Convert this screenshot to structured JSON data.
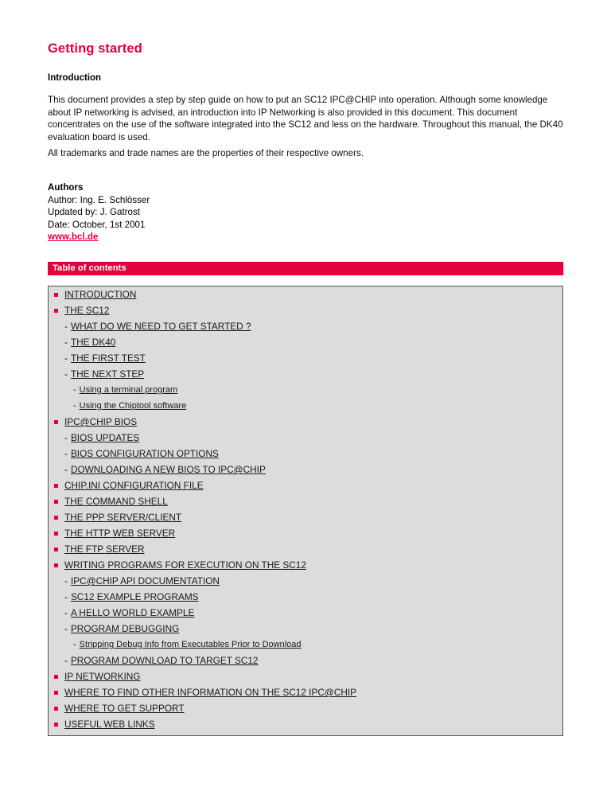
{
  "document": {
    "title": "Getting started",
    "title_color": "#E4003C"
  },
  "introduction": {
    "heading": "Introduction",
    "paragraph_1": "This document provides a step by step guide on how to put an SC12 IPC@CHIP into operation. Although some knowledge about IP networking is advised, an introduction into IP Networking is also provided in this document. This document concentrates on the use of the software integrated into the SC12 and less on the hardware. Throughout this manual, the DK40 evaluation board is used.",
    "paragraph_2": "All trademarks and trade names are the properties of their respective owners."
  },
  "authors": {
    "heading": "Authors",
    "author": "Author: Ing. E. Schlösser",
    "updated_by": "Updated by: J. Gatrost",
    "date": "Date: October, 1st 2001",
    "website": "www.bcl.de"
  },
  "toc": {
    "bar_label": "Table of contents",
    "bar_color": "#E4003C",
    "box_background": "#DCDCDC",
    "bullet_color": "#E4003C",
    "dash": "-",
    "items": [
      {
        "level": 1,
        "label": "INTRODUCTION"
      },
      {
        "level": 1,
        "label": "THE SC12"
      },
      {
        "level": 2,
        "label": "WHAT DO WE NEED TO GET STARTED ?"
      },
      {
        "level": 2,
        "label": "THE DK40"
      },
      {
        "level": 2,
        "label": "THE FIRST TEST"
      },
      {
        "level": 2,
        "label": "THE NEXT STEP"
      },
      {
        "level": 3,
        "label": "Using a terminal program"
      },
      {
        "level": 3,
        "label": "Using the Chiptool software"
      },
      {
        "level": 1,
        "label": "IPC@CHIP BIOS"
      },
      {
        "level": 2,
        "label": "BIOS UPDATES"
      },
      {
        "level": 2,
        "label": "BIOS CONFIGURATION OPTIONS"
      },
      {
        "level": 2,
        "label": "DOWNLOADING A NEW BIOS TO IPC@CHIP"
      },
      {
        "level": 1,
        "label": "CHIP.INI CONFIGURATION FILE"
      },
      {
        "level": 1,
        "label": "THE COMMAND SHELL"
      },
      {
        "level": 1,
        "label": "THE PPP SERVER/CLIENT"
      },
      {
        "level": 1,
        "label": "THE HTTP WEB SERVER"
      },
      {
        "level": 1,
        "label": "THE FTP SERVER"
      },
      {
        "level": 1,
        "label": "WRITING PROGRAMS FOR EXECUTION ON THE SC12"
      },
      {
        "level": 2,
        "label": "IPC@CHIP API DOCUMENTATION"
      },
      {
        "level": 2,
        "label": "SC12 EXAMPLE PROGRAMS"
      },
      {
        "level": 2,
        "label": "A HELLO WORLD EXAMPLE"
      },
      {
        "level": 2,
        "label": "PROGRAM DEBUGGING"
      },
      {
        "level": 3,
        "label": "Stripping Debug Info from Executables Prior to Download"
      },
      {
        "level": 2,
        "label": "PROGRAM DOWNLOAD TO TARGET SC12"
      },
      {
        "level": 1,
        "label": "IP NETWORKING"
      },
      {
        "level": 1,
        "label": "WHERE TO FIND OTHER INFORMATION ON THE SC12 IPC@CHIP"
      },
      {
        "level": 1,
        "label": "WHERE TO GET SUPPORT"
      },
      {
        "level": 1,
        "label": "USEFUL WEB LINKS"
      }
    ]
  }
}
